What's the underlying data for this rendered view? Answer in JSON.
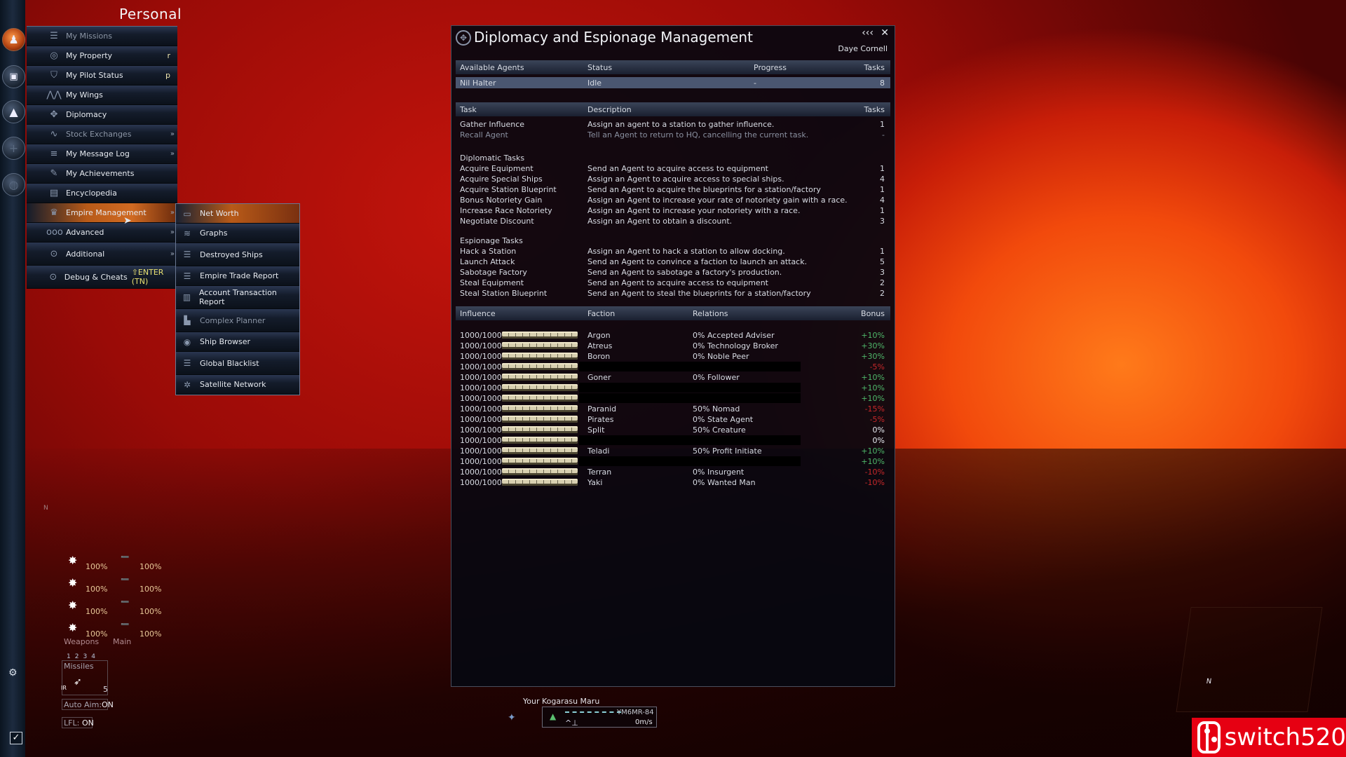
{
  "personal_menu": {
    "title": "Personal",
    "items": [
      {
        "label": "My Missions",
        "icon": "missions-icon",
        "key": "",
        "arrow": false,
        "dim": true
      },
      {
        "label": "My Property",
        "icon": "property-icon",
        "key": "r",
        "arrow": false
      },
      {
        "label": "My Pilot Status",
        "icon": "pilot-icon",
        "key": "p",
        "arrow": false
      },
      {
        "label": "My Wings",
        "icon": "wings-icon",
        "key": "",
        "arrow": false
      },
      {
        "label": "Diplomacy",
        "icon": "diplomacy-icon",
        "key": "",
        "arrow": false
      },
      {
        "label": "Stock Exchanges",
        "icon": "stock-icon",
        "key": "",
        "arrow": true,
        "dim": true
      },
      {
        "label": "My Message Log",
        "icon": "message-log-icon",
        "key": "",
        "arrow": true
      },
      {
        "label": "My Achievements",
        "icon": "achievements-icon",
        "key": "",
        "arrow": false
      },
      {
        "label": "Encyclopedia",
        "icon": "encyclopedia-icon",
        "key": "",
        "arrow": false
      },
      {
        "label": "Empire Management",
        "icon": "crown-icon",
        "key": "",
        "arrow": true,
        "active": true
      },
      {
        "label": "Advanced",
        "icon": "advanced-icon",
        "key": "",
        "arrow": true
      },
      {
        "label": "Additional",
        "icon": "additional-icon",
        "key": "",
        "arrow": true
      },
      {
        "label": "Debug & Cheats",
        "icon": "debug-icon",
        "hotkey": "⇧ENTER (TN)"
      }
    ],
    "arrow_glyph": "»"
  },
  "empire_submenu": {
    "items": [
      {
        "label": "Net Worth",
        "icon": "net-worth-icon",
        "active": true
      },
      {
        "label": "Graphs",
        "icon": "graphs-icon"
      },
      {
        "label": "Destroyed Ships",
        "icon": "destroyed-ships-icon"
      },
      {
        "label": "Empire Trade Report",
        "icon": "trade-report-icon"
      },
      {
        "label": "Account Transaction Report",
        "icon": "transaction-report-icon"
      },
      {
        "label": "Complex Planner",
        "icon": "complex-planner-icon",
        "dim": true
      },
      {
        "label": "Ship Browser",
        "icon": "ship-browser-icon"
      },
      {
        "label": "Global Blacklist",
        "icon": "blacklist-icon"
      },
      {
        "label": "Satellite Network",
        "icon": "satellite-icon"
      }
    ]
  },
  "dialog": {
    "title": "Diplomacy and Espionage Management",
    "minimize_glyph": "‹‹‹",
    "close_glyph": "✕",
    "user": "Daye Cornell",
    "agents": {
      "headers": [
        "Available Agents",
        "Status",
        "Progress",
        "Tasks"
      ],
      "rows": [
        {
          "name": "Nil Halter",
          "status": "Idle",
          "progress": "-",
          "tasks": "8"
        }
      ]
    },
    "tasks": {
      "headers": [
        "Task",
        "Description",
        "Tasks"
      ],
      "general": [
        {
          "task": "Gather Influence",
          "desc": "Assign an agent to a station to gather influence.",
          "count": "1"
        },
        {
          "task": "Recall Agent",
          "desc": "Tell an Agent to return to HQ, cancelling the current task.",
          "count": "-",
          "dim": true
        }
      ],
      "diplomatic_title": "Diplomatic Tasks",
      "diplomatic": [
        {
          "task": "Acquire Equipment",
          "desc": "Send an Agent to acquire access to equipment",
          "count": "1"
        },
        {
          "task": "Acquire Special Ships",
          "desc": "Assign an Agent to acquire access to special ships.",
          "count": "4"
        },
        {
          "task": "Acquire Station Blueprint",
          "desc": "Send an Agent to acquire the blueprints for a station/factory",
          "count": "1"
        },
        {
          "task": "Bonus Notoriety Gain",
          "desc": "Assign an Agent to increase your rate of notoriety gain with a race.",
          "count": "4"
        },
        {
          "task": "Increase Race Notoriety",
          "desc": "Assign an Agent to increase your notoriety with a race.",
          "count": "1"
        },
        {
          "task": "Negotiate Discount",
          "desc": "Assign an Agent to obtain a discount.",
          "count": "3"
        }
      ],
      "espionage_title": "Espionage Tasks",
      "espionage": [
        {
          "task": "Hack a Station",
          "desc": "Assign an Agent to hack a station to allow docking.",
          "count": "1"
        },
        {
          "task": "Launch Attack",
          "desc": "Send an Agent to convince a faction to launch an attack.",
          "count": "5"
        },
        {
          "task": "Sabotage Factory",
          "desc": "Send an Agent to sabotage a factory's production.",
          "count": "3"
        },
        {
          "task": "Steal Equipment",
          "desc": "Send an Agent to acquire access to equipment",
          "count": "2"
        },
        {
          "task": "Steal Station Blueprint",
          "desc": "Send an Agent to steal the blueprints for a station/factory",
          "count": "2"
        }
      ]
    },
    "influence": {
      "headers": [
        "Influence",
        "Faction",
        "Relations",
        "Bonus"
      ],
      "rows": [
        {
          "influence": "1000/1000",
          "fill": 1.0,
          "faction": "Argon",
          "relations": "0% Accepted Adviser",
          "bonus": "+10%",
          "tone": "pos"
        },
        {
          "influence": "1000/1000",
          "fill": 1.0,
          "faction": "Atreus",
          "relations": "0% Technology Broker",
          "bonus": "+30%",
          "tone": "pos"
        },
        {
          "influence": "1000/1000",
          "fill": 1.0,
          "faction": "Boron",
          "relations": "0% Noble Peer",
          "bonus": "+30%",
          "tone": "pos"
        },
        {
          "influence": "1000/1000",
          "fill": 1.0,
          "faction": "",
          "relations": "",
          "bonus": "-5%",
          "tone": "neg",
          "hidden": true
        },
        {
          "influence": "1000/1000",
          "fill": 1.0,
          "faction": "Goner",
          "relations": "0% Follower",
          "bonus": "+10%",
          "tone": "pos"
        },
        {
          "influence": "1000/1000",
          "fill": 1.0,
          "faction": "",
          "relations": "",
          "bonus": "+10%",
          "tone": "pos",
          "hidden": true
        },
        {
          "influence": "1000/1000",
          "fill": 1.0,
          "faction": "",
          "relations": "",
          "bonus": "+10%",
          "tone": "pos",
          "hidden": true
        },
        {
          "influence": "1000/1000",
          "fill": 1.0,
          "faction": "Paranid",
          "relations": "50% Nomad",
          "bonus": "-15%",
          "tone": "neg"
        },
        {
          "influence": "1000/1000",
          "fill": 1.0,
          "faction": "Pirates",
          "relations": "0% State Agent",
          "bonus": "-5%",
          "tone": "neg"
        },
        {
          "influence": "1000/1000",
          "fill": 1.0,
          "faction": "Split",
          "relations": "50% Creature",
          "bonus": "0%",
          "tone": "zero"
        },
        {
          "influence": "1000/1000",
          "fill": 1.0,
          "faction": "",
          "relations": "",
          "bonus": "0%",
          "tone": "zero",
          "hidden": true
        },
        {
          "influence": "1000/1000",
          "fill": 1.0,
          "faction": "Teladi",
          "relations": "50% Profit Initiate",
          "bonus": "+10%",
          "tone": "pos"
        },
        {
          "influence": "1000/1000",
          "fill": 1.0,
          "faction": "",
          "relations": "",
          "bonus": "+10%",
          "tone": "pos",
          "hidden": true
        },
        {
          "influence": "1000/1000",
          "fill": 1.0,
          "faction": "Terran",
          "relations": "0% Insurgent",
          "bonus": "-10%",
          "tone": "neg"
        },
        {
          "influence": "1000/1000",
          "fill": 1.0,
          "faction": "Yaki",
          "relations": "0% Wanted Man",
          "bonus": "-10%",
          "tone": "neg"
        }
      ]
    }
  },
  "hud": {
    "weapons": [
      {
        "left": "100%",
        "right": "100%"
      },
      {
        "left": "100%",
        "right": "100%"
      },
      {
        "left": "100%",
        "right": "100%"
      },
      {
        "left": "100%",
        "right": "100%"
      }
    ],
    "weapons_label": "Weapons",
    "main_label": "Main",
    "groups": [
      "1",
      "2",
      "3",
      "4"
    ],
    "missiles_label": "Missiles",
    "missile_type": "IR",
    "missile_count": "5",
    "auto_aim_label": "Auto Aim:",
    "auto_aim_value": "ON",
    "lfl_label": "LFL:",
    "lfl_value": "ON",
    "compass_n": "N",
    "left_n": "N"
  },
  "ship": {
    "name": "Your Kogarasu Maru",
    "id": "YM6MR-84",
    "speed": "0m/s"
  },
  "watermark": {
    "text": "switch520"
  }
}
